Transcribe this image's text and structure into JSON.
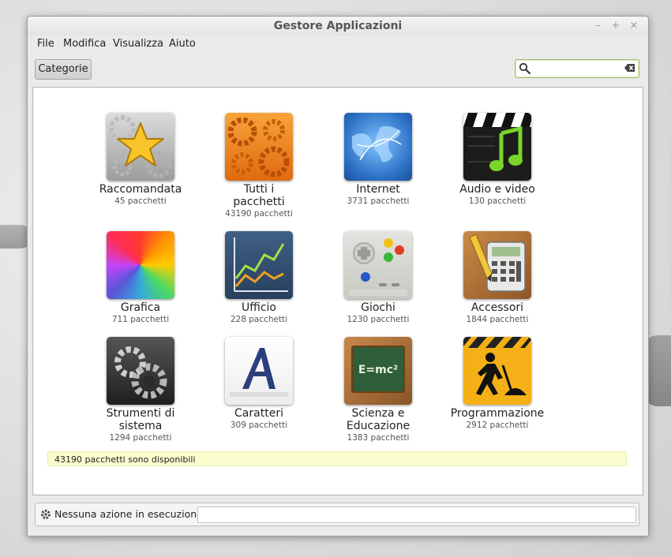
{
  "window": {
    "title": "Gestore Applicazioni",
    "controls": {
      "minimize": "–",
      "maximize": "+",
      "close": "×"
    }
  },
  "menu": [
    "File",
    "Modifica",
    "Visualizza",
    "Aiuto"
  ],
  "toolbar": {
    "categories_label": "Categorie",
    "search_value": ""
  },
  "categories": [
    {
      "label": "Raccomandata",
      "count": "45 pacchetti",
      "icon": "star-gears-icon"
    },
    {
      "label": "Tutti i pacchetti",
      "count": "43190 pacchetti",
      "icon": "orange-gears-icon"
    },
    {
      "label": "Internet",
      "count": "3731 pacchetti",
      "icon": "globe-icon"
    },
    {
      "label": "Audio e video",
      "count": "130 pacchetti",
      "icon": "clapperboard-music-icon"
    },
    {
      "label": "Grafica",
      "count": "711 pacchetti",
      "icon": "color-swirl-icon"
    },
    {
      "label": "Ufficio",
      "count": "228 pacchetti",
      "icon": "line-chart-icon"
    },
    {
      "label": "Giochi",
      "count": "1230 pacchetti",
      "icon": "gamepad-icon"
    },
    {
      "label": "Accessori",
      "count": "1844 pacchetti",
      "icon": "calculator-pencil-icon"
    },
    {
      "label": "Strumenti di sistema",
      "count": "1294 pacchetti",
      "icon": "system-gears-icon"
    },
    {
      "label": "Caratteri",
      "count": "309 pacchetti",
      "icon": "font-letter-icon"
    },
    {
      "label": "Scienza e Educazione",
      "count": "1383 pacchetti",
      "icon": "chalkboard-icon"
    },
    {
      "label": "Programmazione",
      "count": "2912 pacchetti",
      "icon": "construction-sign-icon"
    }
  ],
  "icon_text": {
    "chalkboard": "E=mc²"
  },
  "notice": "43190 pacchetti sono disponibili",
  "status": {
    "text": "Nessuna azione in esecuzione"
  },
  "colors": {
    "notice_bg": "#fbfcce",
    "search_border": "#a0c070"
  }
}
